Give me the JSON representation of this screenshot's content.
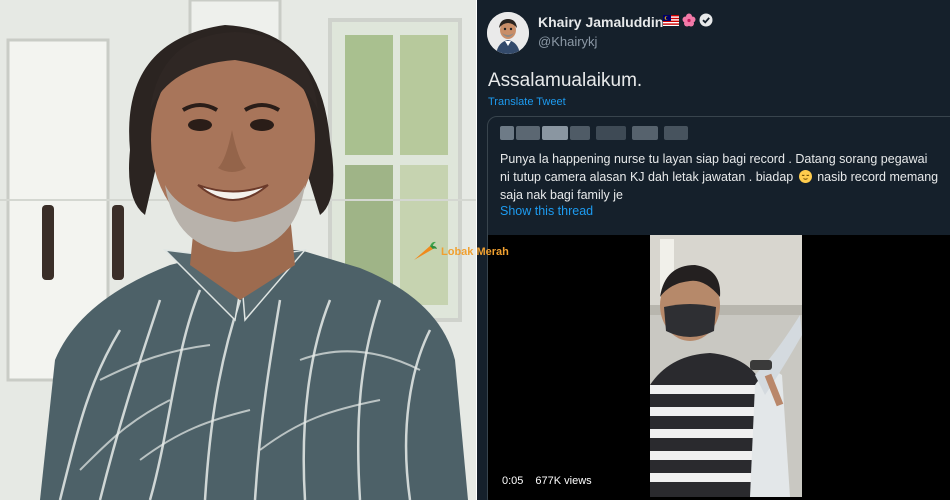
{
  "tweet": {
    "author_name": "Khairy Jamaluddin",
    "handle": "@Khairykj",
    "text": "Assalamualaikum.",
    "translate_label": "Translate Tweet",
    "flag_icons": [
      "malaysia-flag-icon",
      "hibiscus-icon",
      "verified-badge-icon"
    ]
  },
  "quote": {
    "text_part1": "Punya la happening nurse tu layan siap bagi record . Datang sorang pegawai ni tutup camera alasan KJ dah letak jawatan . biadap",
    "text_part2": "nasib record memang saja nak bagi family je",
    "emoji": "relieved-face-icon",
    "show_thread_label": "Show this thread"
  },
  "video": {
    "time": "0:05",
    "views": "677K views"
  },
  "watermark": {
    "text": "Lobak Merah",
    "icon": "carrot-icon"
  },
  "colors": {
    "tweet_bg": "#15202b",
    "link": "#1d9bf0",
    "text": "#e7e9ea",
    "muted": "#8b98a5",
    "border": "#38444d",
    "watermark": "#f0a030"
  }
}
